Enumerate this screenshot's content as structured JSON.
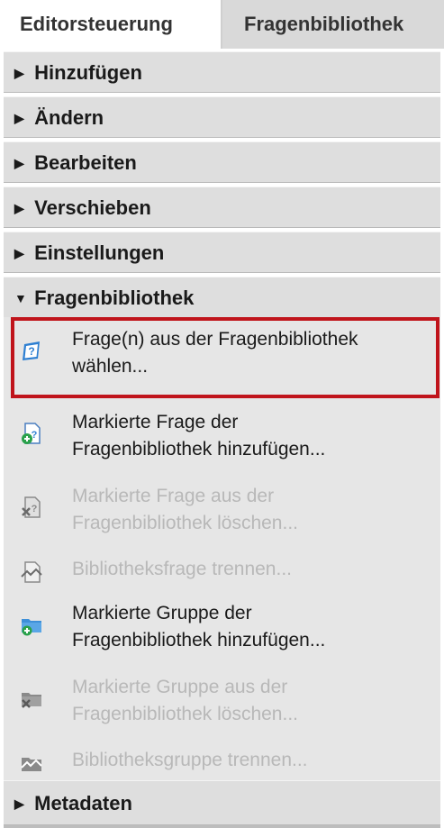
{
  "tabs": {
    "editor": "Editorsteuerung",
    "library": "Fragenbibliothek"
  },
  "sections": {
    "add": "Hinzufügen",
    "change": "Ändern",
    "edit": "Bearbeiten",
    "move": "Verschieben",
    "settings": "Einstellungen",
    "library": "Fragenbibliothek",
    "metadata": "Metadaten"
  },
  "library_items": [
    {
      "label_line1": "Frage(n) aus der Fragenbibliothek",
      "label_line2": "wählen...",
      "enabled": true,
      "icon": "question-library-icon",
      "highlighted": true
    },
    {
      "label_line1": "Markierte Frage der",
      "label_line2": "Fragenbibliothek hinzufügen...",
      "enabled": true,
      "icon": "add-question-icon"
    },
    {
      "label_line1": "Markierte Frage aus der",
      "label_line2": "Fragenbibliothek löschen...",
      "enabled": false,
      "icon": "delete-question-icon"
    },
    {
      "label_line1": "Bibliotheksfrage trennen...",
      "enabled": false,
      "icon": "unlink-question-icon"
    },
    {
      "label_line1": "Markierte Gruppe der",
      "label_line2": "Fragenbibliothek hinzufügen...",
      "enabled": true,
      "icon": "add-group-folder-icon"
    },
    {
      "label_line1": "Markierte Gruppe aus der",
      "label_line2": "Fragenbibliothek löschen...",
      "enabled": false,
      "icon": "delete-group-folder-icon"
    },
    {
      "label_line1": "Bibliotheksgruppe trennen...",
      "enabled": false,
      "icon": "unlink-group-icon"
    }
  ],
  "colors": {
    "highlight": "#c0141b",
    "section_bg": "#dedede",
    "content_bg": "#e6e6e6",
    "disabled_text": "#b8b8b8"
  }
}
